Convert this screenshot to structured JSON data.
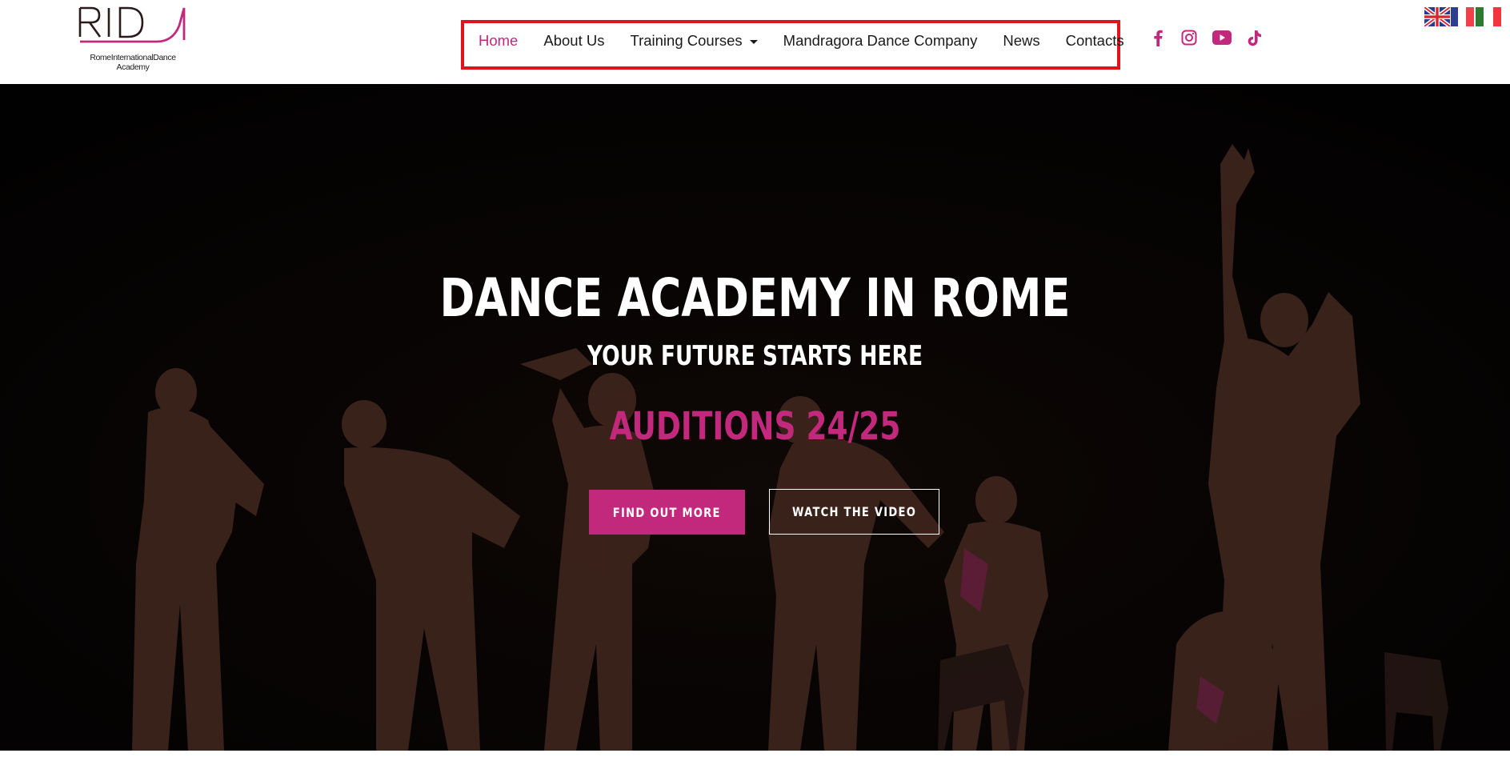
{
  "header": {
    "logo": {
      "wordmark": "RID",
      "subtitle_line1": "RomeInternationalDance",
      "subtitle_line2": "Academy"
    },
    "nav": [
      {
        "label": "Home",
        "active": true,
        "has_dropdown": false
      },
      {
        "label": "About Us",
        "active": false,
        "has_dropdown": false
      },
      {
        "label": "Training Courses",
        "active": false,
        "has_dropdown": true
      },
      {
        "label": "Mandragora Dance Company",
        "active": false,
        "has_dropdown": false
      },
      {
        "label": "News",
        "active": false,
        "has_dropdown": false
      },
      {
        "label": "Contacts",
        "active": false,
        "has_dropdown": false
      }
    ],
    "socials": [
      {
        "name": "facebook",
        "icon": "facebook-icon"
      },
      {
        "name": "instagram",
        "icon": "instagram-icon"
      },
      {
        "name": "youtube",
        "icon": "youtube-icon"
      },
      {
        "name": "tiktok",
        "icon": "tiktok-icon"
      }
    ],
    "languages": [
      {
        "code": "en",
        "icon": "uk-flag-icon"
      },
      {
        "code": "it",
        "icon": "italy-flag-icon"
      }
    ]
  },
  "hero": {
    "title": "DANCE ACADEMY IN ROME",
    "subtitle": "YOUR FUTURE STARTS HERE",
    "highlight": "AUDITIONS 24/25",
    "primary_button": "FIND OUT MORE",
    "secondary_button": "WATCH THE VIDEO"
  },
  "colors": {
    "accent": "#c2297d",
    "highlight_box": "#e0141e",
    "hero_background": "#050303",
    "text_dark": "#1a1a1a",
    "white": "#ffffff"
  }
}
